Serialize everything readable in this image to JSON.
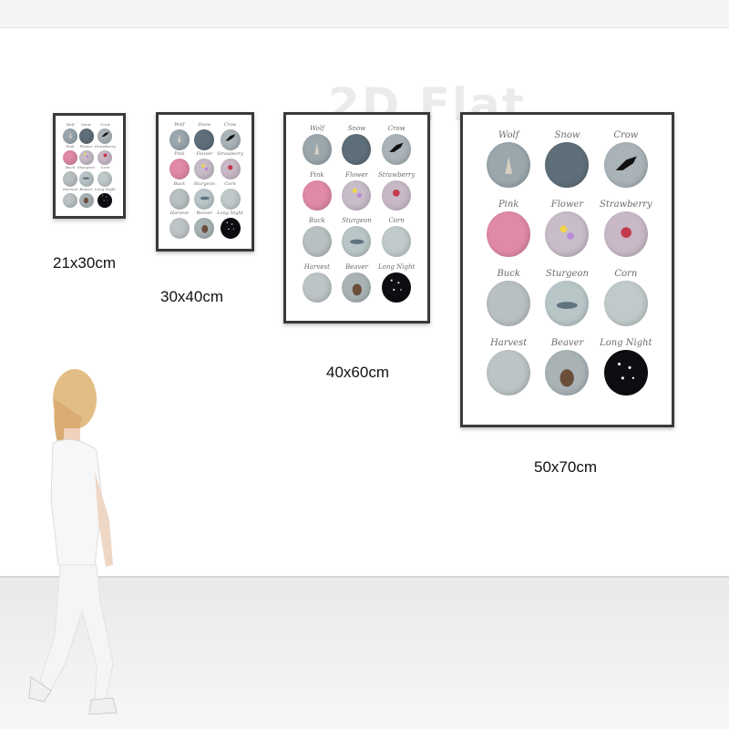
{
  "watermark": "2D Flat",
  "posters": [
    {
      "size_label": "21x30cm"
    },
    {
      "size_label": "30x40cm"
    },
    {
      "size_label": "40x60cm"
    },
    {
      "size_label": "50x70cm"
    }
  ],
  "moons": [
    {
      "label": "Wolf",
      "color": "#9aa7ad",
      "icon": "wolf-icon"
    },
    {
      "label": "Snow",
      "color": "#5f6f7a",
      "icon": "snowflake-icon"
    },
    {
      "label": "Crow",
      "color": "#aab3b8",
      "icon": "crow-icon"
    },
    {
      "label": "Pink",
      "color": "#e08aa6",
      "icon": "none"
    },
    {
      "label": "Flower",
      "color": "#c7bcc8",
      "icon": "flower-icon"
    },
    {
      "label": "Strawberry",
      "color": "#c9b9c7",
      "icon": "strawberry-icon"
    },
    {
      "label": "Buck",
      "color": "#b9c0c2",
      "icon": "deer-icon"
    },
    {
      "label": "Sturgeon",
      "color": "#b9c6c8",
      "icon": "fish-icon"
    },
    {
      "label": "Corn",
      "color": "#c1caca",
      "icon": "corn-icon"
    },
    {
      "label": "Harvest",
      "color": "#bdc4c6",
      "icon": "branch-icon"
    },
    {
      "label": "Beaver",
      "color": "#a9b3b6",
      "icon": "beaver-icon"
    },
    {
      "label": "Long Night",
      "color": "#0e0e12",
      "icon": "stars-icon"
    }
  ]
}
